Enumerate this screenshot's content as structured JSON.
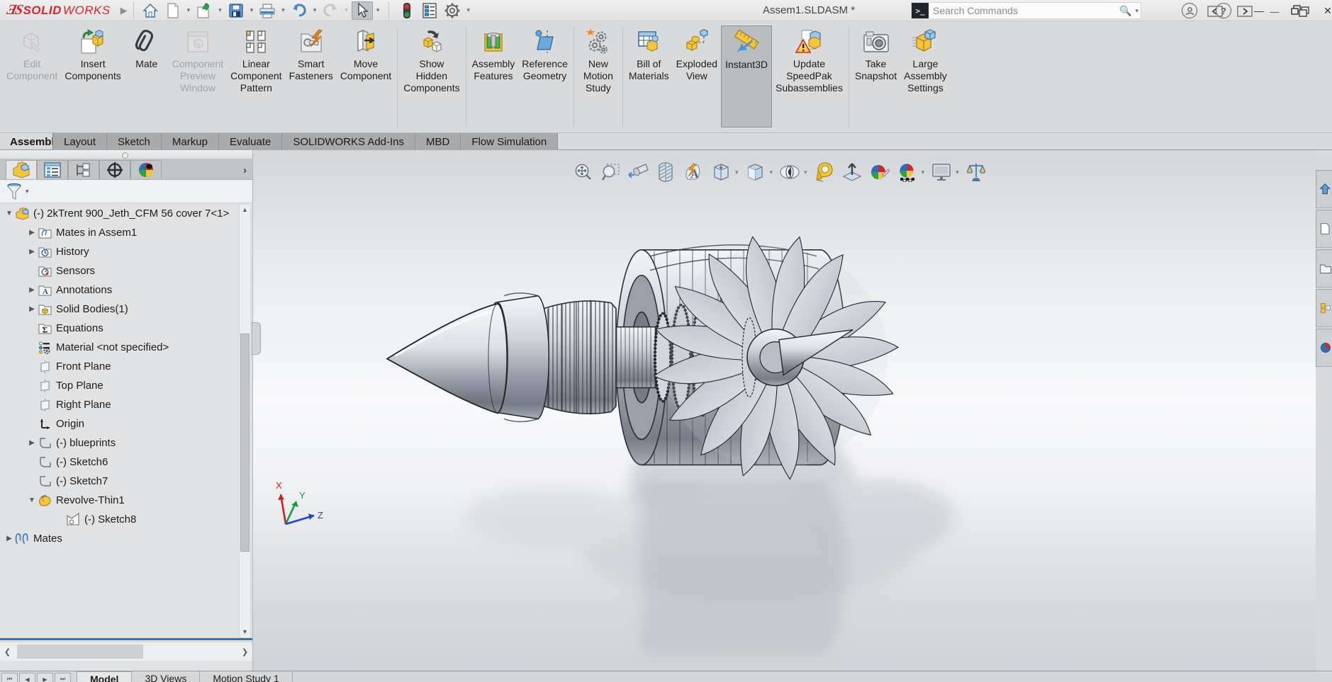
{
  "titlebar": {
    "brand_solid": "SOLID",
    "brand_works": "WORKS",
    "document_title": "Assem1.SLDASM *",
    "search_placeholder": "Search Commands"
  },
  "colors": {
    "brand_red": "#d6252d",
    "selection_blue": "#2779bd",
    "ribbon_active_bg": "#b9bdc0"
  },
  "ribbon": {
    "buttons": [
      {
        "label": "Edit\nComponent",
        "state": "disabled",
        "dropdown": true
      },
      {
        "label": "Insert\nComponents",
        "state": "normal",
        "dropdown": true
      },
      {
        "label": "Mate",
        "state": "normal",
        "dropdown": false
      },
      {
        "label": "Component\nPreview\nWindow",
        "state": "disabled",
        "dropdown": false
      },
      {
        "label": "Linear\nComponent\nPattern",
        "state": "normal",
        "dropdown": true
      },
      {
        "label": "Smart\nFasteners",
        "state": "normal",
        "dropdown": false
      },
      {
        "label": "Move\nComponent",
        "state": "normal",
        "dropdown": true
      },
      {
        "label": "Show\nHidden\nComponents",
        "state": "normal",
        "dropdown": false
      },
      {
        "label": "Assembly\nFeatures",
        "state": "normal",
        "dropdown": false
      },
      {
        "label": "Reference\nGeometry",
        "state": "normal",
        "dropdown": true
      },
      {
        "label": "New\nMotion\nStudy",
        "state": "normal",
        "dropdown": false
      },
      {
        "label": "Bill of\nMaterials",
        "state": "normal",
        "dropdown": false
      },
      {
        "label": "Exploded\nView",
        "state": "normal",
        "dropdown": true
      },
      {
        "label": "Instant3D",
        "state": "active",
        "dropdown": false
      },
      {
        "label": "Update\nSpeedPak\nSubassemblies",
        "state": "normal",
        "dropdown": false
      },
      {
        "label": "Take\nSnapshot",
        "state": "normal",
        "dropdown": false
      },
      {
        "label": "Large\nAssembly\nSettings",
        "state": "normal",
        "dropdown": false
      }
    ]
  },
  "command_tabs": {
    "active": "Assembly",
    "items": [
      "Assembly",
      "Layout",
      "Sketch",
      "Markup",
      "Evaluate",
      "SOLIDWORKS Add-Ins",
      "MBD",
      "Flow Simulation"
    ]
  },
  "feature_tree": {
    "items": [
      {
        "label": "(-) 2kTrent 900_Jeth_CFM 56 cover 7<1>",
        "icon": "assembly-component",
        "expand": "open",
        "level": 0
      },
      {
        "label": "Mates in Assem1",
        "icon": "folder-mates",
        "expand": "closed",
        "level": 1
      },
      {
        "label": "History",
        "icon": "folder-history",
        "expand": "closed",
        "level": 1
      },
      {
        "label": "Sensors",
        "icon": "folder-sensors",
        "expand": "none",
        "level": 1
      },
      {
        "label": "Annotations",
        "icon": "folder-annotations",
        "expand": "closed",
        "level": 1
      },
      {
        "label": "Solid Bodies(1)",
        "icon": "folder-solid-bodies",
        "expand": "closed",
        "level": 1
      },
      {
        "label": "Equations",
        "icon": "folder-equations",
        "expand": "none",
        "level": 1
      },
      {
        "label": "Material <not specified>",
        "icon": "material",
        "expand": "none",
        "level": 1
      },
      {
        "label": "Front Plane",
        "icon": "plane",
        "expand": "none",
        "level": 1
      },
      {
        "label": "Top Plane",
        "icon": "plane",
        "expand": "none",
        "level": 1
      },
      {
        "label": "Right Plane",
        "icon": "plane",
        "expand": "none",
        "level": 1
      },
      {
        "label": "Origin",
        "icon": "origin",
        "expand": "none",
        "level": 1
      },
      {
        "label": "(-) blueprints",
        "icon": "sketch",
        "expand": "closed",
        "level": 1
      },
      {
        "label": "(-) Sketch6",
        "icon": "sketch",
        "expand": "none",
        "level": 1
      },
      {
        "label": "(-) Sketch7",
        "icon": "sketch",
        "expand": "none",
        "level": 1
      },
      {
        "label": "Revolve-Thin1",
        "icon": "revolve",
        "expand": "open",
        "level": 1
      },
      {
        "label": "(-) Sketch8",
        "icon": "sketch-absorbed",
        "expand": "none",
        "level": 2
      },
      {
        "label": "Mates",
        "icon": "mates-group",
        "expand": "closed",
        "level": 0
      }
    ]
  },
  "viewport": {
    "triad": {
      "x": "X",
      "y": "Y",
      "z": "Z"
    },
    "heads_up_icons": [
      "zoom-to-fit",
      "zoom-to-area",
      "previous-view",
      "section-view",
      "dynamic-annotation-views",
      "view-orientation",
      "display-style",
      "hide-show-items",
      "measure",
      "3d-drawing-view",
      "edit-appearance",
      "apply-scene",
      "view-settings",
      "compare"
    ]
  },
  "statusbar": {
    "tabs": [
      "Model",
      "3D Views",
      "Motion Study 1"
    ],
    "active": "Model"
  }
}
